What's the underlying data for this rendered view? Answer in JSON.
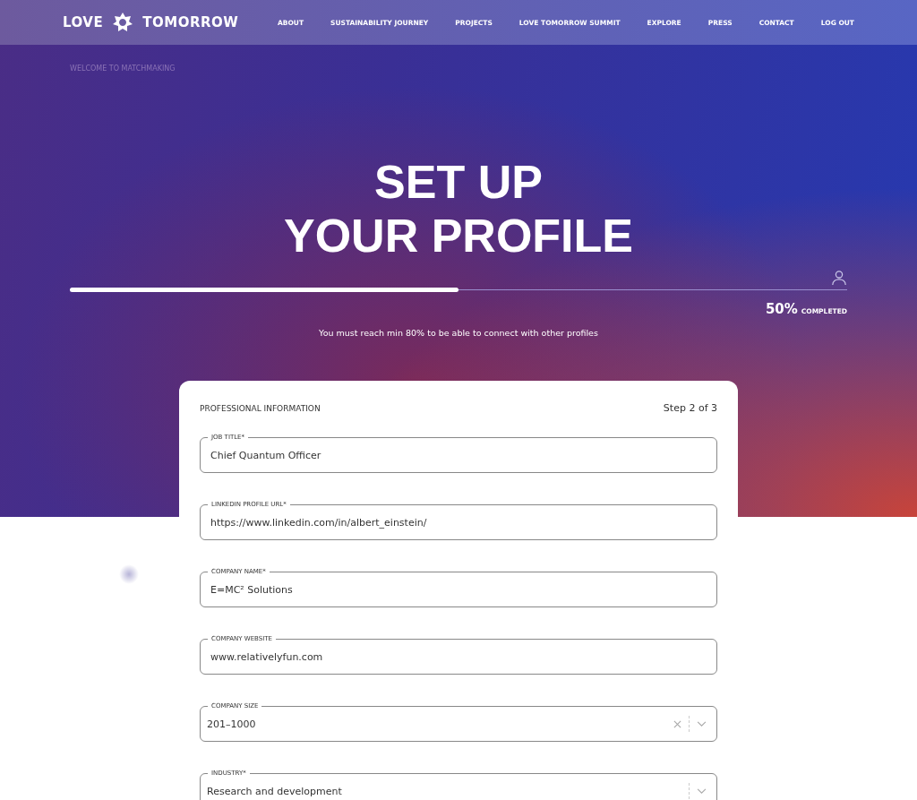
{
  "header": {
    "logo_left": "LOVE",
    "logo_right": "TOMORROW",
    "nav": [
      "ABOUT",
      "SUSTAINABILITY JOURNEY",
      "PROJECTS",
      "LOVE TOMORROW SUMMIT",
      "EXPLORE",
      "PRESS",
      "CONTACT",
      "LOG OUT"
    ]
  },
  "hero": {
    "breadcrumb": "WELCOME TO MATCHMAKING",
    "title_lines": [
      "SET UP",
      "YOUR PROFILE"
    ],
    "progress": {
      "level": 0.5,
      "percent": "50%",
      "label": "COMPLETED"
    },
    "note": "You must reach min 80% to be able to connect with other profiles"
  },
  "form": {
    "section": "PROFESSIONAL INFORMATION",
    "step": "Step 2 of 3",
    "fields": [
      {
        "kind": "text",
        "label": "JOB TITLE*",
        "value": "Chief Quantum Officer"
      },
      {
        "kind": "text",
        "label": "LINKEDIN PROFILE URL*",
        "value": "https://www.linkedin.com/in/albert_einstein/"
      },
      {
        "kind": "text",
        "label": "COMPANY NAME*",
        "value": "E=MC² Solutions"
      },
      {
        "kind": "text",
        "label": "COMPANY WEBSITE",
        "value": "www.relativelyfun.com"
      },
      {
        "kind": "select",
        "label": "COMPANY SIZE",
        "value": "201–1000",
        "clearable": true
      },
      {
        "kind": "select",
        "label": "INDUSTRY*",
        "value": "Research and development",
        "clearable": false
      }
    ]
  }
}
